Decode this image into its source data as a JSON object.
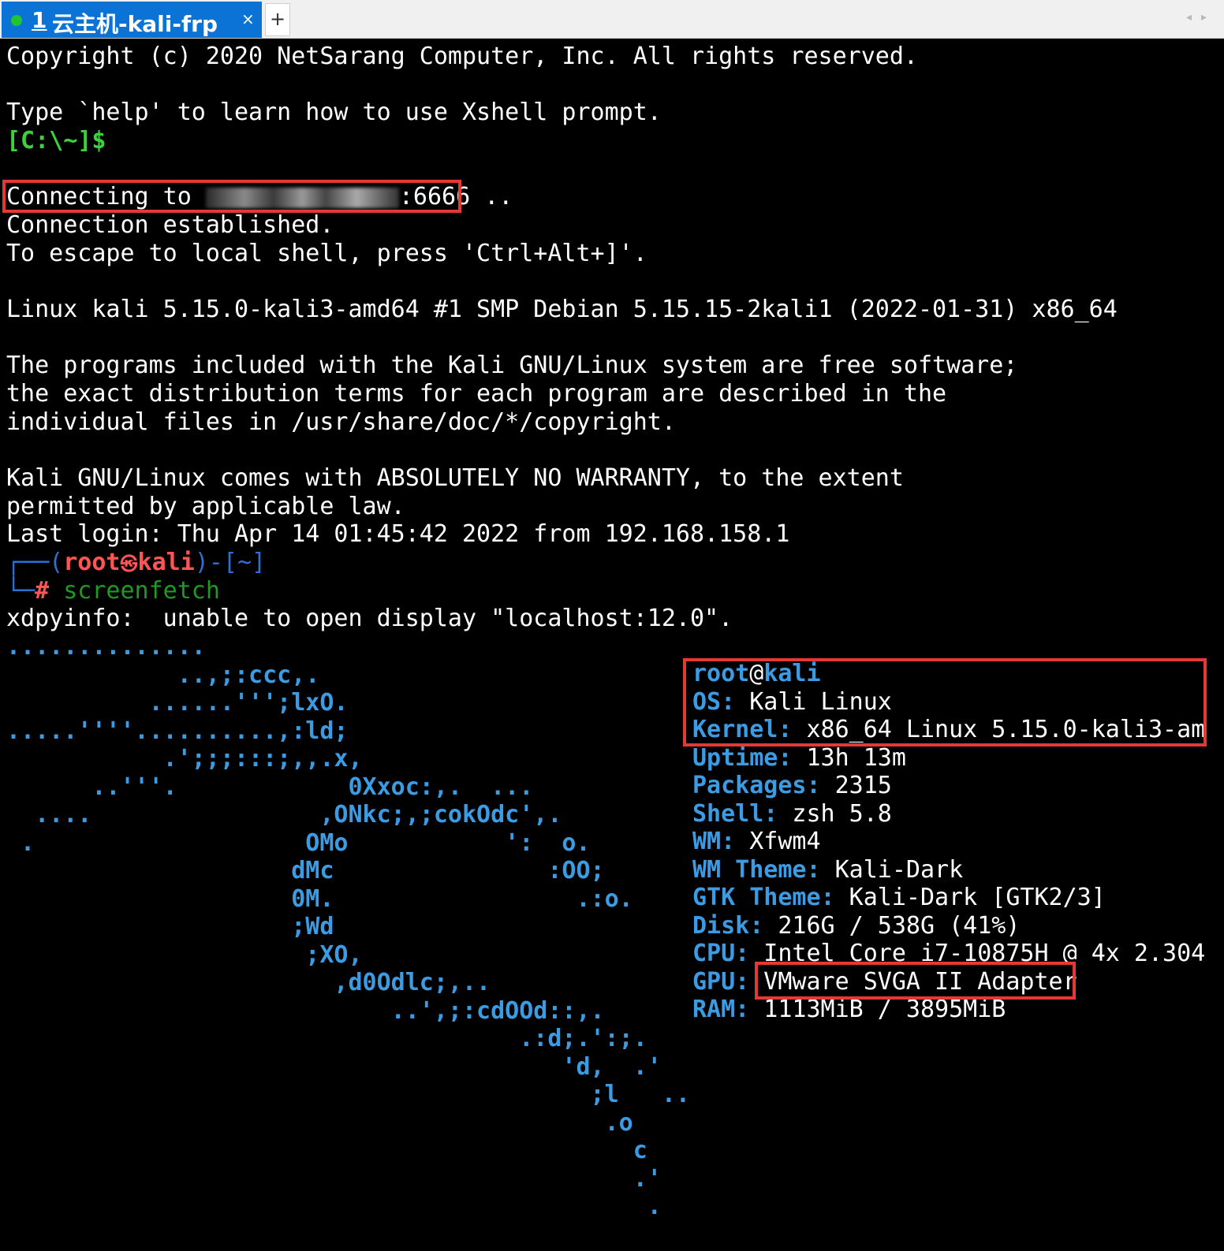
{
  "tab": {
    "number": "1",
    "title": "云主机-kali-frp",
    "close_glyph": "×",
    "add_glyph": "+",
    "arrows": "◂▸"
  },
  "colors": {
    "tab_active": "#0b73d6",
    "prompt_green": "#3bd33b",
    "kali_blue": "#3b9ce3",
    "root_red": "#ff5555",
    "highlight_red": "#e53935"
  },
  "terminal": {
    "copyright": "Copyright (c) 2020 NetSarang Computer, Inc. All rights reserved.",
    "help_line": "Type `help' to learn how to use Xshell prompt.",
    "local_prompt": "[C:\\~]$",
    "connecting_prefix": "Connecting to ",
    "connecting_port": ":6666",
    "connecting_suffix": " ..",
    "established": "Connection established.",
    "escape": "To escape to local shell, press 'Ctrl+Alt+]'.",
    "uname": "Linux kali 5.15.0-kali3-amd64 #1 SMP Debian 5.15.15-2kali1 (2022-01-31) x86_64",
    "motd": [
      "The programs included with the Kali GNU/Linux system are free software;",
      "the exact distribution terms for each program are described in the",
      "individual files in /usr/share/doc/*/copyright.",
      "",
      "Kali GNU/Linux comes with ABSOLUTELY NO WARRANTY, to the extent",
      "permitted by applicable law."
    ],
    "last_login": "Last login: Thu Apr 14 01:45:42 2022 from 192.168.158.1",
    "prompt": {
      "frame_top": "┌──(",
      "user": "root",
      "at_symbol": "㉿",
      "host": "kali",
      "dir": ")-[~]",
      "frame_bottom": "└─",
      "hash": "#",
      "command": "screenfetch"
    },
    "xdpy_error": "xdpyinfo:  unable to open display \"localhost:12.0\".",
    "ascii_art": [
      "..............",
      "            ..,;:ccc,.",
      "          ......''';lxO.",
      ".....''''..........,:ld;",
      "           .';;;:::;,,.x,",
      "      ..'''.            0Xxoc:,.  ...",
      "  ....                ,ONkc;,;cokOdc',.",
      " .                   OMo           ':  o.",
      "                    dMc               :OO;",
      "                    0M.                 .:o.",
      "                    ;Wd",
      "                     ;XO,",
      "                       ,d0Odlc;,..",
      "                           ..',;:cdOOd::,.",
      "                                    .:d;.':;.",
      "                                       'd,  .'",
      "                                         ;l   ..",
      "                                          .o",
      "                                            c",
      "                                            .'",
      "                                             ."
    ],
    "info": {
      "user_host": {
        "user": "root",
        "at": "@",
        "host": "kali"
      },
      "lines": [
        {
          "label": "OS:",
          "value": " Kali Linux"
        },
        {
          "label": "Kernel:",
          "value": " x86_64 Linux 5.15.0-kali3-am"
        },
        {
          "label": "Uptime:",
          "value": " 13h 13m"
        },
        {
          "label": "Packages:",
          "value": " 2315"
        },
        {
          "label": "Shell:",
          "value": " zsh 5.8"
        },
        {
          "label": "WM:",
          "value": " Xfwm4"
        },
        {
          "label": "WM Theme:",
          "value": " Kali-Dark"
        },
        {
          "label": "GTK Theme:",
          "value": " Kali-Dark [GTK2/3]"
        },
        {
          "label": "Disk:",
          "value": " 216G / 538G (41%)"
        },
        {
          "label": "CPU:",
          "value": " Intel Core i7-10875H @ 4x 2.304"
        },
        {
          "label": "GPU:",
          "value": " VMware SVGA II Adapter"
        },
        {
          "label": "RAM:",
          "value": " 1113MiB / 3895MiB"
        }
      ]
    }
  }
}
